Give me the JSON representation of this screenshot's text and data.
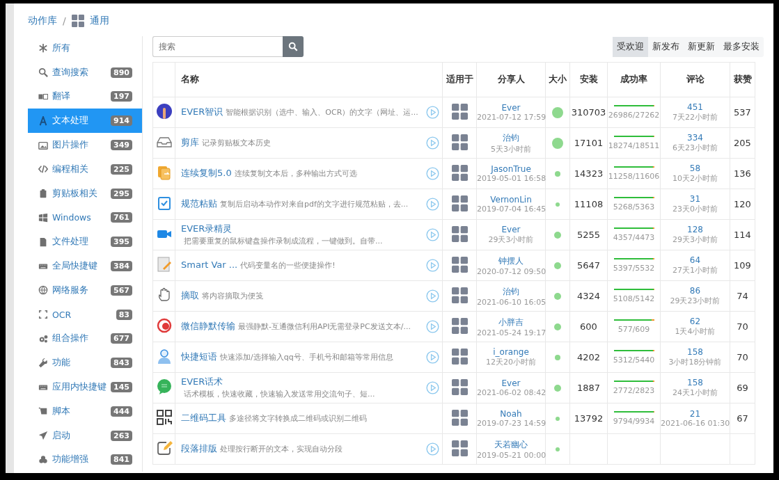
{
  "breadcrumb": {
    "root": "动作库",
    "separator": "/",
    "current": "通用"
  },
  "sidebar": {
    "items": [
      {
        "label": "所有",
        "selected": false
      },
      {
        "label": "查询搜索",
        "count": "890",
        "selected": false
      },
      {
        "label": "翻译",
        "count": "197",
        "selected": false
      },
      {
        "label": "文本处理",
        "count": "914",
        "selected": true
      },
      {
        "label": "图片操作",
        "count": "349",
        "selected": false
      },
      {
        "label": "编程相关",
        "count": "225",
        "selected": false
      },
      {
        "label": "剪贴板相关",
        "count": "295",
        "selected": false
      },
      {
        "label": "Windows",
        "count": "761",
        "selected": false
      },
      {
        "label": "文件处理",
        "count": "395",
        "selected": false
      },
      {
        "label": "全局快捷键",
        "count": "384",
        "selected": false
      },
      {
        "label": "网络服务",
        "count": "567",
        "selected": false
      },
      {
        "label": "OCR",
        "count": "83",
        "selected": false
      },
      {
        "label": "组合操作",
        "count": "677",
        "selected": false
      },
      {
        "label": "功能",
        "count": "843",
        "selected": false
      },
      {
        "label": "应用内快捷键",
        "count": "145",
        "selected": false
      },
      {
        "label": "脚本",
        "count": "444",
        "selected": false
      },
      {
        "label": "启动",
        "count": "263",
        "selected": false
      },
      {
        "label": "功能增强",
        "count": "841",
        "selected": false
      }
    ]
  },
  "search": {
    "placeholder": "搜索"
  },
  "sort_tabs": [
    {
      "label": "受欢迎",
      "selected": true
    },
    {
      "label": "新发布",
      "selected": false
    },
    {
      "label": "新更新",
      "selected": false
    },
    {
      "label": "最多安装",
      "selected": false
    }
  ],
  "table": {
    "columns": [
      "名称",
      "适用于",
      "分享人",
      "大小",
      "安装",
      "成功率",
      "评论",
      "获赞"
    ],
    "rows": [
      {
        "name": "EVER智识",
        "description": "智能根据识别（选中、输入、OCR）的文字（网址、运...",
        "wrap": false,
        "playable": true,
        "sharer": "Ever",
        "shared": "2021-07-12 17:59",
        "kind": "large",
        "installs": "310703",
        "rate": {
          "level": 0.99,
          "text": "26986/27262"
        },
        "comments": "451",
        "commented": "7天22小时前",
        "likes": "537"
      },
      {
        "name": "剪库",
        "description": "记录剪贴板文本历史",
        "wrap": false,
        "playable": true,
        "sharer": "治钧",
        "shared": "5天3小时前",
        "kind": "large",
        "installs": "17101",
        "rate": {
          "level": 0.987,
          "text": "18274/18511"
        },
        "comments": "334",
        "commented": "6天23小时前",
        "likes": "205"
      },
      {
        "name": "连续复制5.0",
        "description": "连续复制文本后，多种输出方式可选",
        "wrap": false,
        "playable": true,
        "sharer": "JasonTrue",
        "shared": "2019-05-01 16:58",
        "kind": "small",
        "installs": "14323",
        "rate": {
          "level": 0.97,
          "text": "11258/11606"
        },
        "comments": "58",
        "commented": "10天2小时前",
        "likes": "136"
      },
      {
        "name": "规范粘贴",
        "description": "复制后启动本动作对来自pdf的文字进行规范粘贴，去...",
        "wrap": false,
        "playable": true,
        "sharer": "VernonLin",
        "shared": "2019-07-04 16:45",
        "kind": "tiny",
        "installs": "11108",
        "rate": {
          "level": 0.982,
          "text": "5268/5363"
        },
        "comments": "31",
        "commented": "23天0小时前",
        "likes": "120"
      },
      {
        "name": "EVER录精灵",
        "description": "把需要重复的鼠标键盘操作录制成流程，一键做到。自带...",
        "wrap": true,
        "playable": true,
        "sharer": "Ever",
        "shared": "29天3小时前",
        "kind": "medium",
        "installs": "5255",
        "rate": {
          "level": 0.974,
          "text": "4357/4473"
        },
        "comments": "128",
        "commented": "29天3小时前",
        "likes": "114"
      },
      {
        "name": "Smart Var ...",
        "description": "代码变量名的一些便捷操作!",
        "wrap": false,
        "playable": true,
        "sharer": "钟摆人",
        "shared": "2020-07-12 09:50",
        "kind": "medium",
        "installs": "5647",
        "rate": {
          "level": 0.976,
          "text": "5397/5532"
        },
        "comments": "64",
        "commented": "27天1小时前",
        "likes": "109"
      },
      {
        "name": "摘取",
        "description": "将内容摘取为便笺",
        "wrap": false,
        "playable": true,
        "sharer": "治钧",
        "shared": "2021-06-10 16:05",
        "kind": "medium",
        "installs": "4324",
        "rate": {
          "level": 0.993,
          "text": "5108/5142"
        },
        "comments": "86",
        "commented": "29天23小时前",
        "likes": "74"
      },
      {
        "name": "微信静默传输",
        "description": "最强静默-互通微信利用API无需登录PC发送文本/...",
        "wrap": false,
        "playable": true,
        "sharer": "小胖吉",
        "shared": "2021-05-24 19:17",
        "kind": "medium",
        "installs": "600",
        "rate": {
          "level": 0.947,
          "text": "577/609"
        },
        "comments": "62",
        "commented": "1天4小时前",
        "likes": "70"
      },
      {
        "name": "快捷短语",
        "description": "快速添加/选择输入qq号、手机号和邮箱等常用信息",
        "wrap": false,
        "playable": true,
        "sharer": "i_orange",
        "shared": "12天20小时前",
        "kind": "small",
        "installs": "4202",
        "rate": {
          "level": 0.976,
          "text": "5312/5440"
        },
        "comments": "158",
        "commented": "3小时18分钟前",
        "likes": "70"
      },
      {
        "name": "EVER话术",
        "description": "话术模板，快速收藏，快速输入发送常用交流句子、短...",
        "wrap": true,
        "playable": true,
        "sharer": "Ever",
        "shared": "2021-06-02 08:42",
        "kind": "medium",
        "installs": "1887",
        "rate": {
          "level": 0.982,
          "text": "2772/2823"
        },
        "comments": "158",
        "commented": "24天1小时前",
        "likes": "69"
      },
      {
        "name": "二维码工具",
        "description": "多途径将文字转换成二维码或识别二维码",
        "wrap": false,
        "playable": false,
        "sharer": "Noah",
        "shared": "2019-07-23 14:59",
        "kind": "tiny",
        "installs": "13792",
        "rate": {
          "level": 0.986,
          "text": "9794/9934"
        },
        "comments": "21",
        "commented": "2021-06-16 01:30",
        "likes": "67"
      },
      {
        "name": "段落排版",
        "description": "处理按行断开的文本，实现自动分段",
        "wrap": false,
        "playable": true,
        "sharer": "天若幽心",
        "shared": "2019-05-21 00:00",
        "kind": "tiny"
      }
    ]
  }
}
